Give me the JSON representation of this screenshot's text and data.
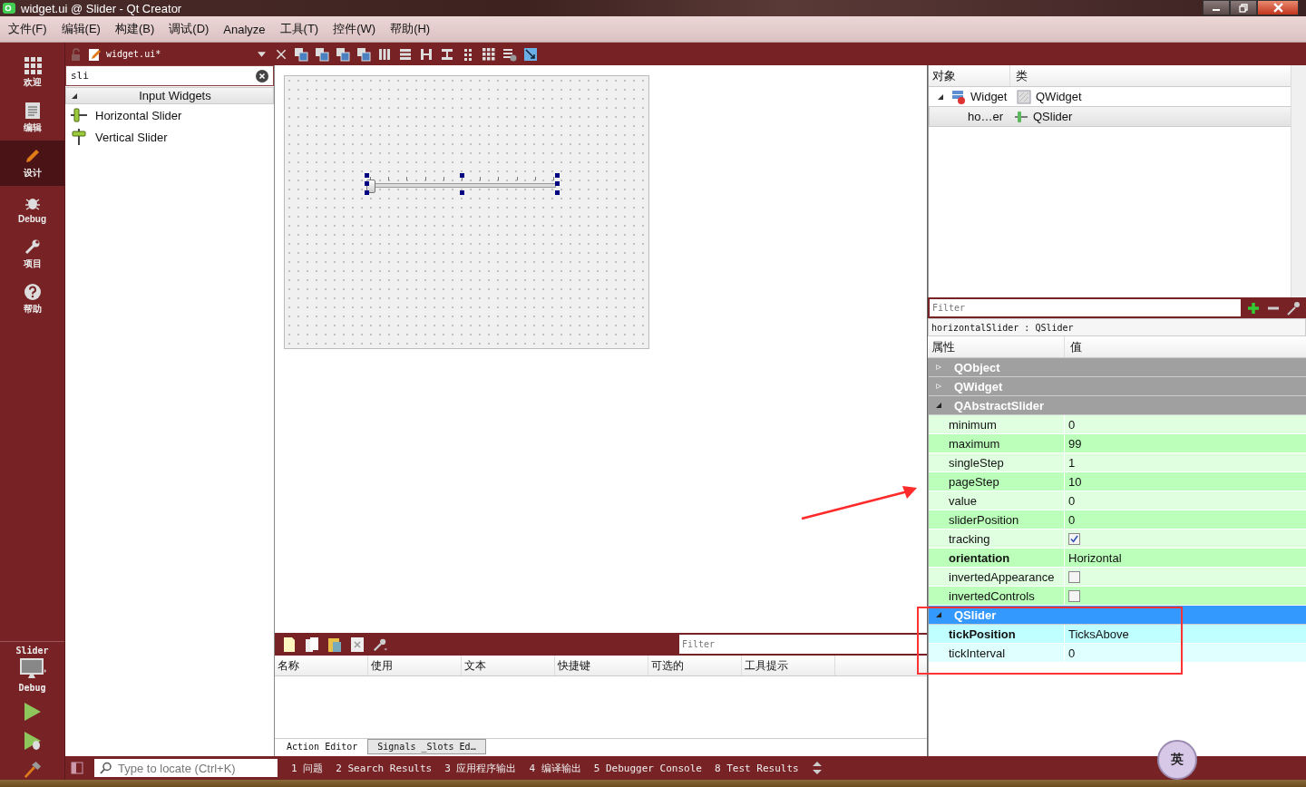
{
  "window": {
    "title": "widget.ui @ Slider - Qt Creator"
  },
  "menu": [
    "文件(F)",
    "编辑(E)",
    "构建(B)",
    "调试(D)",
    "Analyze",
    "工具(T)",
    "控件(W)",
    "帮助(H)"
  ],
  "modes": [
    {
      "label": "欢迎",
      "kind": "grid",
      "selected": false
    },
    {
      "label": "编辑",
      "kind": "document",
      "selected": false
    },
    {
      "label": "设计",
      "kind": "pencil",
      "selected": true
    },
    {
      "label": "Debug",
      "kind": "bug",
      "selected": false
    },
    {
      "label": "项目",
      "kind": "wrench",
      "selected": false
    },
    {
      "label": "帮助",
      "kind": "help",
      "selected": false
    }
  ],
  "target": {
    "project": "Slider",
    "config": "Debug"
  },
  "document": {
    "filename": "widget.ui*"
  },
  "widget_box": {
    "search": "sli",
    "category": "Input Widgets",
    "items": [
      {
        "label": "Horizontal Slider",
        "kind": "hslider"
      },
      {
        "label": "Vertical Slider",
        "kind": "vslider"
      }
    ]
  },
  "form": {
    "slider": {
      "level": 0,
      "selected": true
    }
  },
  "action_editor": {
    "filter_placeholder": "Filter",
    "columns": [
      "名称",
      "使用",
      "文本",
      "快捷键",
      "可选的",
      "工具提示"
    ],
    "tabs": [
      {
        "label": "Action Editor",
        "selected": true
      },
      {
        "label": "Signals _Slots Ed…",
        "selected": false
      }
    ]
  },
  "object_inspector": {
    "columns": [
      "对象",
      "类"
    ],
    "tree": [
      {
        "object": "Widget",
        "class": "QWidget",
        "kind": "widget",
        "expanded": true,
        "selected": false,
        "children": [
          {
            "object": "ho…er",
            "class": "QSlider",
            "kind": "slider",
            "selected": true
          }
        ]
      }
    ]
  },
  "property_editor": {
    "filter_placeholder": "Filter",
    "object_label": "horizontalSlider : QSlider",
    "columns": [
      "属性",
      "值"
    ],
    "groups": [
      {
        "name": "QObject",
        "expanded": false,
        "selected": false
      },
      {
        "name": "QWidget",
        "expanded": false,
        "selected": false
      },
      {
        "name": "QAbstractSlider",
        "expanded": true,
        "selected": false,
        "rows": [
          {
            "name": "minimum",
            "kind": "text",
            "value": "0",
            "changed": false
          },
          {
            "name": "maximum",
            "kind": "text",
            "value": "99",
            "changed": false
          },
          {
            "name": "singleStep",
            "kind": "text",
            "value": "1",
            "changed": false
          },
          {
            "name": "pageStep",
            "kind": "text",
            "value": "10",
            "changed": false
          },
          {
            "name": "value",
            "kind": "text",
            "value": "0",
            "changed": false
          },
          {
            "name": "sliderPosition",
            "kind": "text",
            "value": "0",
            "changed": false
          },
          {
            "name": "tracking",
            "kind": "checkbox",
            "checked": true,
            "changed": false
          },
          {
            "name": "orientation",
            "kind": "text",
            "value": "Horizontal",
            "changed": true
          },
          {
            "name": "invertedAppearance",
            "kind": "checkbox",
            "checked": false,
            "changed": false
          },
          {
            "name": "invertedControls",
            "kind": "checkbox",
            "checked": false,
            "changed": false
          }
        ]
      },
      {
        "name": "QSlider",
        "expanded": true,
        "selected": true,
        "rows": [
          {
            "name": "tickPosition",
            "kind": "text",
            "value": "TicksAbove",
            "changed": true
          },
          {
            "name": "tickInterval",
            "kind": "text",
            "value": "0",
            "changed": false
          }
        ]
      }
    ]
  },
  "status_bar": {
    "locator_placeholder": "Type to locate (Ctrl+K)",
    "panes": [
      "1 问题",
      "2 Search Results",
      "3 应用程序输出",
      "4 编译输出",
      "5 Debugger Console",
      "8 Test Results"
    ]
  },
  "ime_badge": {
    "label": "英"
  }
}
